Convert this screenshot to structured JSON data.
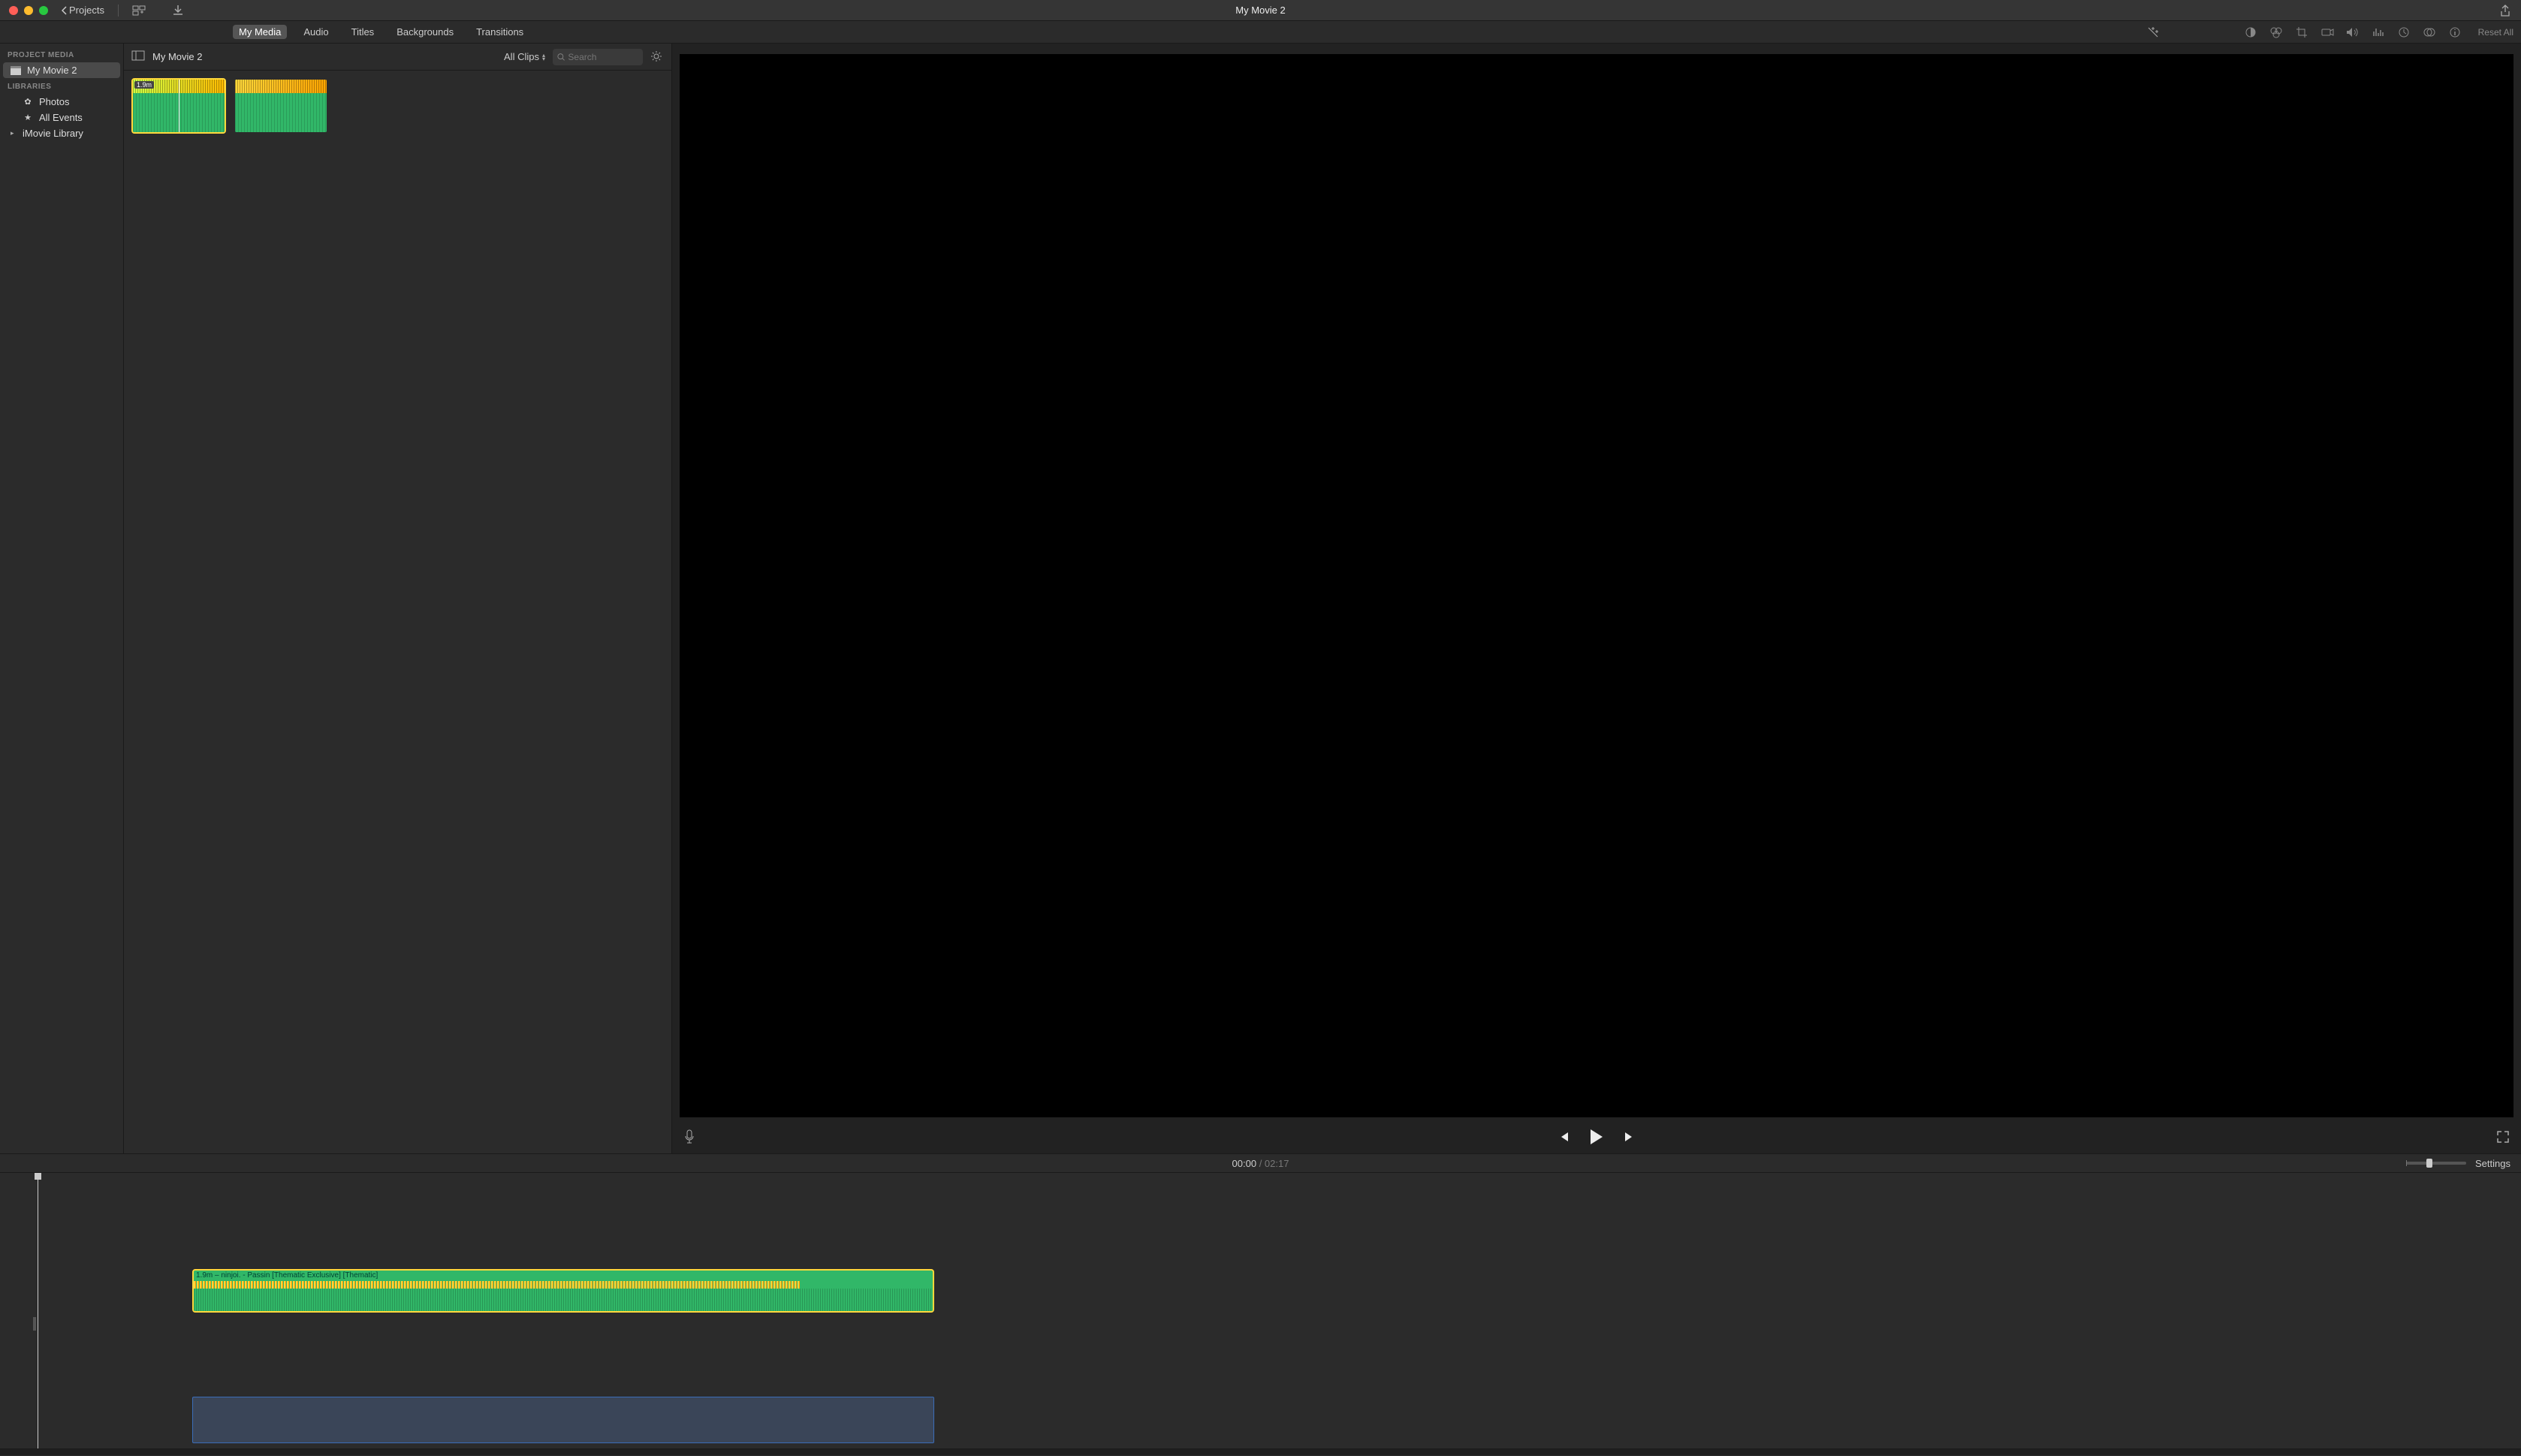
{
  "window": {
    "title": "My Movie 2"
  },
  "titlebar": {
    "back_label": "Projects"
  },
  "tabs": {
    "my_media": "My Media",
    "audio": "Audio",
    "titles": "Titles",
    "backgrounds": "Backgrounds",
    "transitions": "Transitions"
  },
  "viewer_tools": {
    "reset": "Reset All"
  },
  "sidebar": {
    "section1": "PROJECT MEDIA",
    "section2": "LIBRARIES",
    "project": "My Movie 2",
    "photos": "Photos",
    "all_events": "All Events",
    "library": "iMovie Library"
  },
  "browser": {
    "title": "My Movie 2",
    "filter": "All Clips",
    "search_placeholder": "Search",
    "clip1_badge": "1.9m"
  },
  "timeline": {
    "current": "00:00",
    "sep": " / ",
    "total": "02:17",
    "settings": "Settings",
    "clip_title": "1.9m – ninjoi. - Passin [Thematic Exclusive] [Thematic]"
  }
}
